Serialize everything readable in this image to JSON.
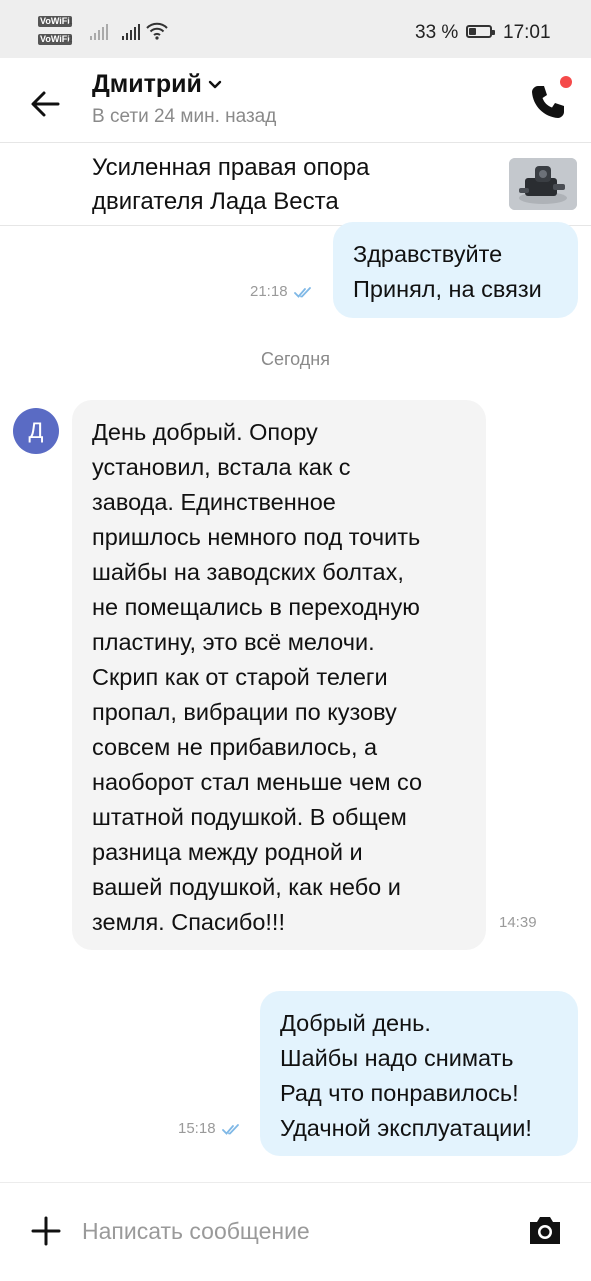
{
  "status_bar": {
    "vowifi_1": "VoWiFi",
    "vowifi_2": "VoWiFi",
    "sim_1": "1",
    "sim_2": "2",
    "battery_percent": "33 %",
    "battery_level": 0.33,
    "time": "17:01",
    "icons": [
      "signal-icon",
      "wifi-icon",
      "battery-icon"
    ]
  },
  "header": {
    "contact_name": "Дмитрий",
    "status": "В сети 24 мин. назад",
    "icons": [
      "back-arrow-icon",
      "chevron-down-icon",
      "phone-icon"
    ],
    "notification_dot_color": "#f54a4a"
  },
  "listing": {
    "title": "Усиленная правая опора двигателя Лада Веста",
    "thumbnail": "engine-mount-photo"
  },
  "messages": [
    {
      "direction": "outgoing",
      "lines": [
        "Здравствуйте",
        "Принял, на связи"
      ],
      "time": "21:18",
      "read": true
    },
    {
      "type": "date_separator",
      "text": "Сегодня"
    },
    {
      "direction": "incoming",
      "avatar_letter": "Д",
      "avatar_color": "#5a6bc4",
      "lines": [
        "День добрый. Опору",
        "установил, встала как с",
        "завода. Единственное",
        "пришлось немного под точить",
        "шайбы на заводских болтах,",
        "не помещались в переходную",
        "пластину, это всё мелочи.",
        "Скрип как от старой телеги",
        "пропал, вибрации по кузову",
        "совсем не прибавилось, а",
        "наоборот стал меньше чем со",
        "штатной подушкой. В общем",
        "разница между родной и",
        "вашей подушкой, как небо и",
        "земля. Спасибо!!!"
      ],
      "time": "14:39"
    },
    {
      "direction": "outgoing",
      "lines": [
        "Добрый день.",
        "Шайбы надо снимать",
        "Рад что понравилось!",
        "Удачной эксплуатации!"
      ],
      "time": "15:18",
      "read": true
    }
  ],
  "composer": {
    "placeholder": "Написать сообщение",
    "value": "",
    "icons": [
      "plus-icon",
      "camera-icon"
    ]
  },
  "colors": {
    "outgoing_bubble": "#e3f3fd",
    "incoming_bubble": "#f4f4f4",
    "read_check": "#7fb8e6",
    "status_bar": "#eeeeee"
  }
}
